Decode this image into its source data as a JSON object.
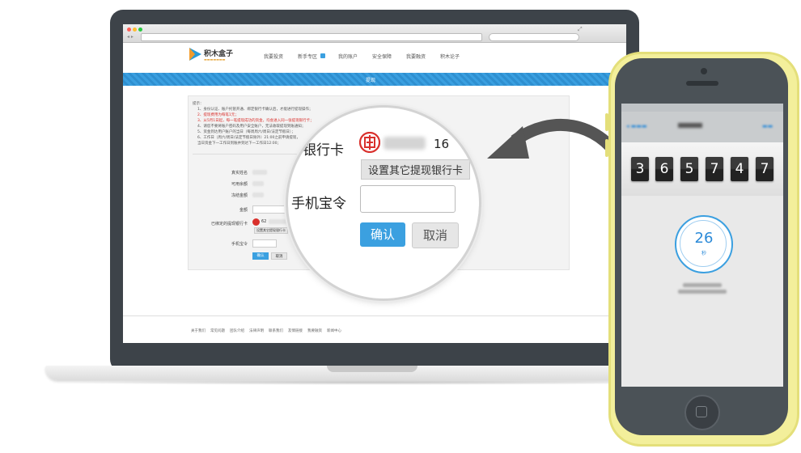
{
  "site": {
    "logo_text": "积木盒子",
    "nav": [
      "我要投资",
      "新手专区",
      "我的账户",
      "安全保障",
      "我要融资",
      "积木论子"
    ],
    "section_title": "提现"
  },
  "notice": {
    "heading": "提示：",
    "items": [
      "1、身份认证、账户托管开通、绑定银行卡确认后，才能进行提现操作；",
      "2、提现费用为每笔1元；",
      "3、从5月1日起，每一笔提现成功的资金，均会进入同一张提现银行卡；",
      "4、请您不要将账户密码及用户安全账户，无法收取提现到账通知；",
      "5、资金到达用户账户的当日（每周周六/周日/法定节假日）；",
      "6、工作日（周六/周日/法定节假日除外）21:00之前申请提现，",
      "  当日资金下一工作日到账并到达下一工作日12:00；"
    ],
    "item_colors": [
      "#555555",
      "#d9302c",
      "#d9302c",
      "#555555",
      "#555555",
      "#555555",
      "#555555"
    ]
  },
  "form": {
    "labels": [
      "真实姓名",
      "可用余额",
      "冻结金额",
      "金额",
      "已绑定的提现银行卡",
      "手机宝令"
    ],
    "bank_prefix": "62",
    "other_bank_link": "设置其它提现银行卡",
    "confirm_label": "确认",
    "cancel_label": "取消"
  },
  "magnifier": {
    "bank_card_label": "银行卡",
    "card_suffix": "16",
    "other_bank_button": "设置其它提现银行卡",
    "token_label": "手机宝令",
    "confirm_label": "确认",
    "cancel_label": "取消"
  },
  "footer": {
    "links": [
      "关于我们",
      "常见问题",
      "团队介绍",
      "法律声明",
      "联系我们",
      "友情链接",
      "我要融资",
      "新闻中心"
    ]
  },
  "phone": {
    "digits": [
      "3",
      "6",
      "5",
      "7",
      "4",
      "7"
    ],
    "timer_value": "26",
    "timer_unit": "秒"
  },
  "colors": {
    "accent_blue": "#3ba0e0",
    "laptop_frame": "#3d4349",
    "phone_frame": "#f3ef9b",
    "arrow": "#555555"
  }
}
